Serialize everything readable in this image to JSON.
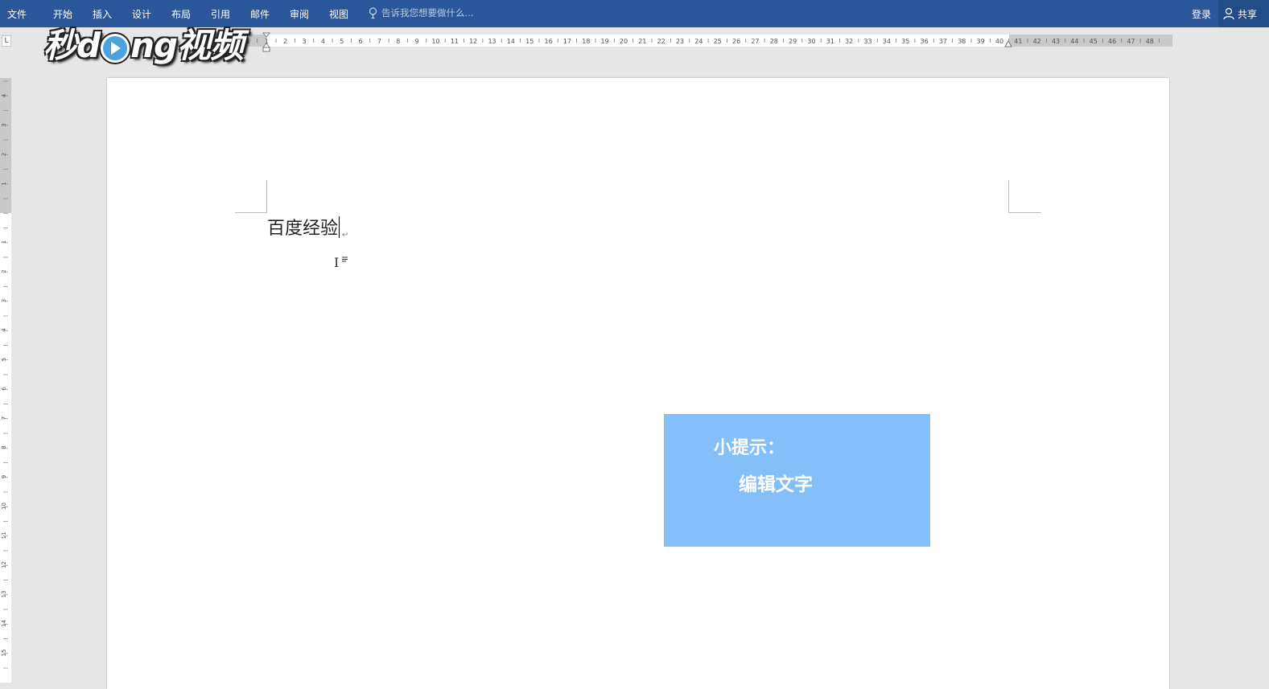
{
  "ribbon": {
    "tabs": [
      "文件",
      "开始",
      "插入",
      "设计",
      "布局",
      "引用",
      "邮件",
      "审阅",
      "视图"
    ],
    "tell_me_placeholder": "告诉我您想要做什么...",
    "sign_in": "登录",
    "share": "共享"
  },
  "ruler": {
    "corner_symbol": "L",
    "h_labels": [
      "1",
      "1",
      "2",
      "3",
      "4",
      "5",
      "6",
      "7",
      "8",
      "9",
      "10",
      "11",
      "12",
      "13",
      "14",
      "15",
      "16",
      "17",
      "18",
      "19",
      "20",
      "21",
      "22",
      "23",
      "24",
      "25",
      "26",
      "27",
      "28",
      "29",
      "30",
      "31",
      "32",
      "33",
      "34",
      "35",
      "36",
      "37",
      "38",
      "39",
      "40",
      "41",
      "42",
      "43",
      "44",
      "45",
      "46",
      "47",
      "48"
    ],
    "v_labels_top": [
      "4",
      "3",
      "2",
      "1"
    ],
    "v_labels": [
      "1",
      "2",
      "3",
      "4",
      "5",
      "6",
      "7",
      "8",
      "9",
      "10",
      "11",
      "12",
      "13",
      "14",
      "15"
    ]
  },
  "watermark": {
    "text_left": "秒d",
    "text_right": "ng视频"
  },
  "document": {
    "body_text": "百度经验",
    "paragraph_mark": "↵"
  },
  "tip": {
    "title": "小提示：",
    "body": "编辑文字"
  },
  "colors": {
    "ribbon": "#2b579a",
    "tip_box": "#85bff9",
    "workspace": "#e6e6e6"
  }
}
